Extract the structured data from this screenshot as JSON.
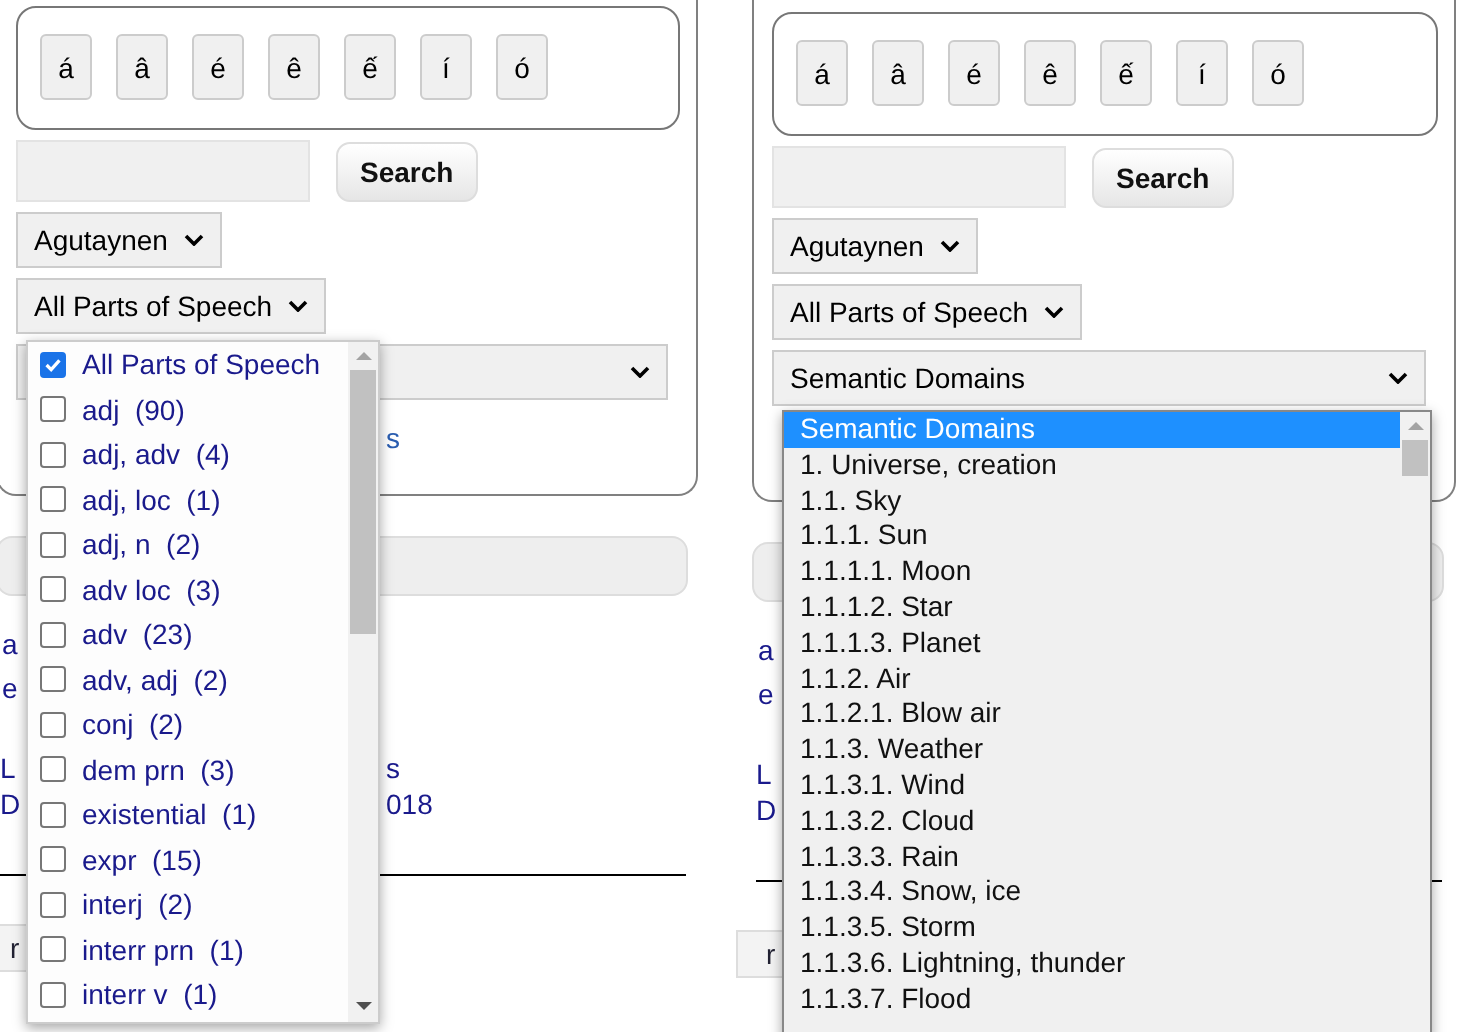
{
  "panels": [
    {
      "special_characters": [
        "á",
        "â",
        "é",
        "ê",
        "ế",
        "í",
        "ó"
      ],
      "search_button": "Search",
      "language_select": "Agutaynen",
      "part_of_speech_select": "All Parts of Speech",
      "link_fragment": "s",
      "result_fragments": [
        "a",
        "e"
      ],
      "info_fragments": [
        {
          "start": "L",
          "end": "s"
        },
        {
          "start": "D",
          "end": "018"
        }
      ],
      "bottom_button": "r",
      "popup": {
        "kind": "checklist",
        "items": [
          {
            "label": "All Parts of Speech",
            "checked": true
          },
          {
            "label": "adj  (90)",
            "checked": false
          },
          {
            "label": "adj, adv  (4)",
            "checked": false
          },
          {
            "label": "adj, loc  (1)",
            "checked": false
          },
          {
            "label": "adj, n  (2)",
            "checked": false
          },
          {
            "label": "adv loc  (3)",
            "checked": false
          },
          {
            "label": "adv  (23)",
            "checked": false
          },
          {
            "label": "adv, adj  (2)",
            "checked": false
          },
          {
            "label": "conj  (2)",
            "checked": false
          },
          {
            "label": "dem prn  (3)",
            "checked": false
          },
          {
            "label": "existential  (1)",
            "checked": false
          },
          {
            "label": "expr  (15)",
            "checked": false
          },
          {
            "label": "interj  (2)",
            "checked": false
          },
          {
            "label": "interr prn  (1)",
            "checked": false
          },
          {
            "label": "interr v  (1)",
            "checked": false
          }
        ]
      }
    },
    {
      "special_characters": [
        "á",
        "â",
        "é",
        "ê",
        "ế",
        "í",
        "ó"
      ],
      "search_button": "Search",
      "language_select": "Agutaynen",
      "part_of_speech_select": "All Parts of Speech",
      "domain_select": "Semantic Domains",
      "result_fragments": [
        "a",
        "e"
      ],
      "info_fragments": [
        {
          "start": "L"
        },
        {
          "start": "D"
        }
      ],
      "bottom_button": "r",
      "popup": {
        "kind": "listbox",
        "items": [
          {
            "label": "Semantic Domains",
            "selected": true
          },
          {
            "label": "1. Universe, creation",
            "selected": false
          },
          {
            "label": "1.1. Sky",
            "selected": false
          },
          {
            "label": "1.1.1. Sun",
            "selected": false
          },
          {
            "label": "1.1.1.1. Moon",
            "selected": false
          },
          {
            "label": "1.1.1.2. Star",
            "selected": false
          },
          {
            "label": "1.1.1.3. Planet",
            "selected": false
          },
          {
            "label": "1.1.2. Air",
            "selected": false
          },
          {
            "label": "1.1.2.1. Blow air",
            "selected": false
          },
          {
            "label": "1.1.3. Weather",
            "selected": false
          },
          {
            "label": "1.1.3.1. Wind",
            "selected": false
          },
          {
            "label": "1.1.3.2. Cloud",
            "selected": false
          },
          {
            "label": "1.1.3.3. Rain",
            "selected": false
          },
          {
            "label": "1.1.3.4. Snow, ice",
            "selected": false
          },
          {
            "label": "1.1.3.5. Storm",
            "selected": false
          },
          {
            "label": "1.1.3.6. Lightning, thunder",
            "selected": false
          },
          {
            "label": "1.1.3.7. Flood",
            "selected": false
          }
        ]
      }
    }
  ]
}
